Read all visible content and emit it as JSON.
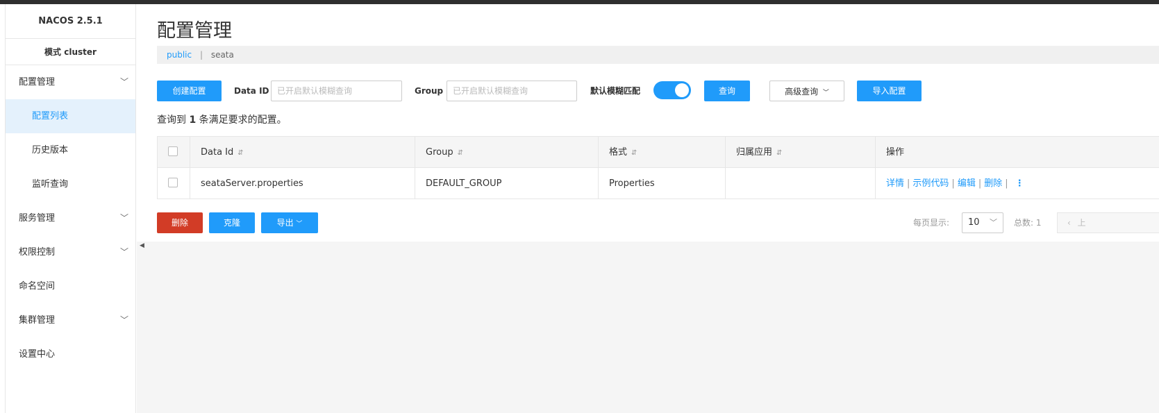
{
  "sidebar": {
    "brand": "NACOS 2.5.1",
    "mode": "模式 cluster",
    "items": [
      {
        "label": "配置管理",
        "chevron": "chevron-down-icon",
        "subitems": [
          {
            "label": "配置列表",
            "active": true
          },
          {
            "label": "历史版本"
          },
          {
            "label": "监听查询"
          }
        ]
      },
      {
        "label": "服务管理",
        "chevron": "chevron-down-icon"
      },
      {
        "label": "权限控制",
        "chevron": "chevron-down-icon"
      },
      {
        "label": "命名空间"
      },
      {
        "label": "集群管理",
        "chevron": "chevron-down-icon"
      },
      {
        "label": "设置中心"
      }
    ]
  },
  "header": {
    "title": "配置管理",
    "breadcrumb": {
      "namespace": "public",
      "separator": "|",
      "current": "seata"
    }
  },
  "toolbar": {
    "create_label": "创建配置",
    "dataid_label": "Data ID",
    "dataid_placeholder": "已开启默认模糊查询",
    "dataid_value": "",
    "group_label": "Group",
    "group_placeholder": "已开启默认模糊查询",
    "group_value": "",
    "fuzzy_label": "默认模糊匹配",
    "fuzzy_on": true,
    "query_label": "查询",
    "advanced_label": "高级查询",
    "advanced_chevron": "chevron-down-icon",
    "import_label": "导入配置"
  },
  "result": {
    "prefix": "查询到",
    "count": "1",
    "suffix": "条满足要求的配置。"
  },
  "table": {
    "headers": {
      "dataid": "Data Id",
      "group": "Group",
      "format": "格式",
      "app": "归属应用",
      "ops": "操作"
    },
    "sort_icon": "⇵",
    "rows": [
      {
        "dataid": "seataServer.properties",
        "group": "DEFAULT_GROUP",
        "format": "Properties",
        "app": "",
        "ops": {
          "detail": "详情",
          "sample": "示例代码",
          "edit": "编辑",
          "delete": "删除",
          "sep": "|",
          "more": "⋮"
        }
      }
    ]
  },
  "bottom": {
    "delete_label": "删除",
    "clone_label": "克隆",
    "export_label": "导出",
    "export_chevron": "chevron-down-icon",
    "page_size_label": "每页显示:",
    "page_size": "10",
    "total_label": "总数: 1",
    "prev_label": "上"
  },
  "colors": {
    "accent": "#209bfa",
    "danger": "#d23c26",
    "active_bg": "#e4f1fc"
  }
}
